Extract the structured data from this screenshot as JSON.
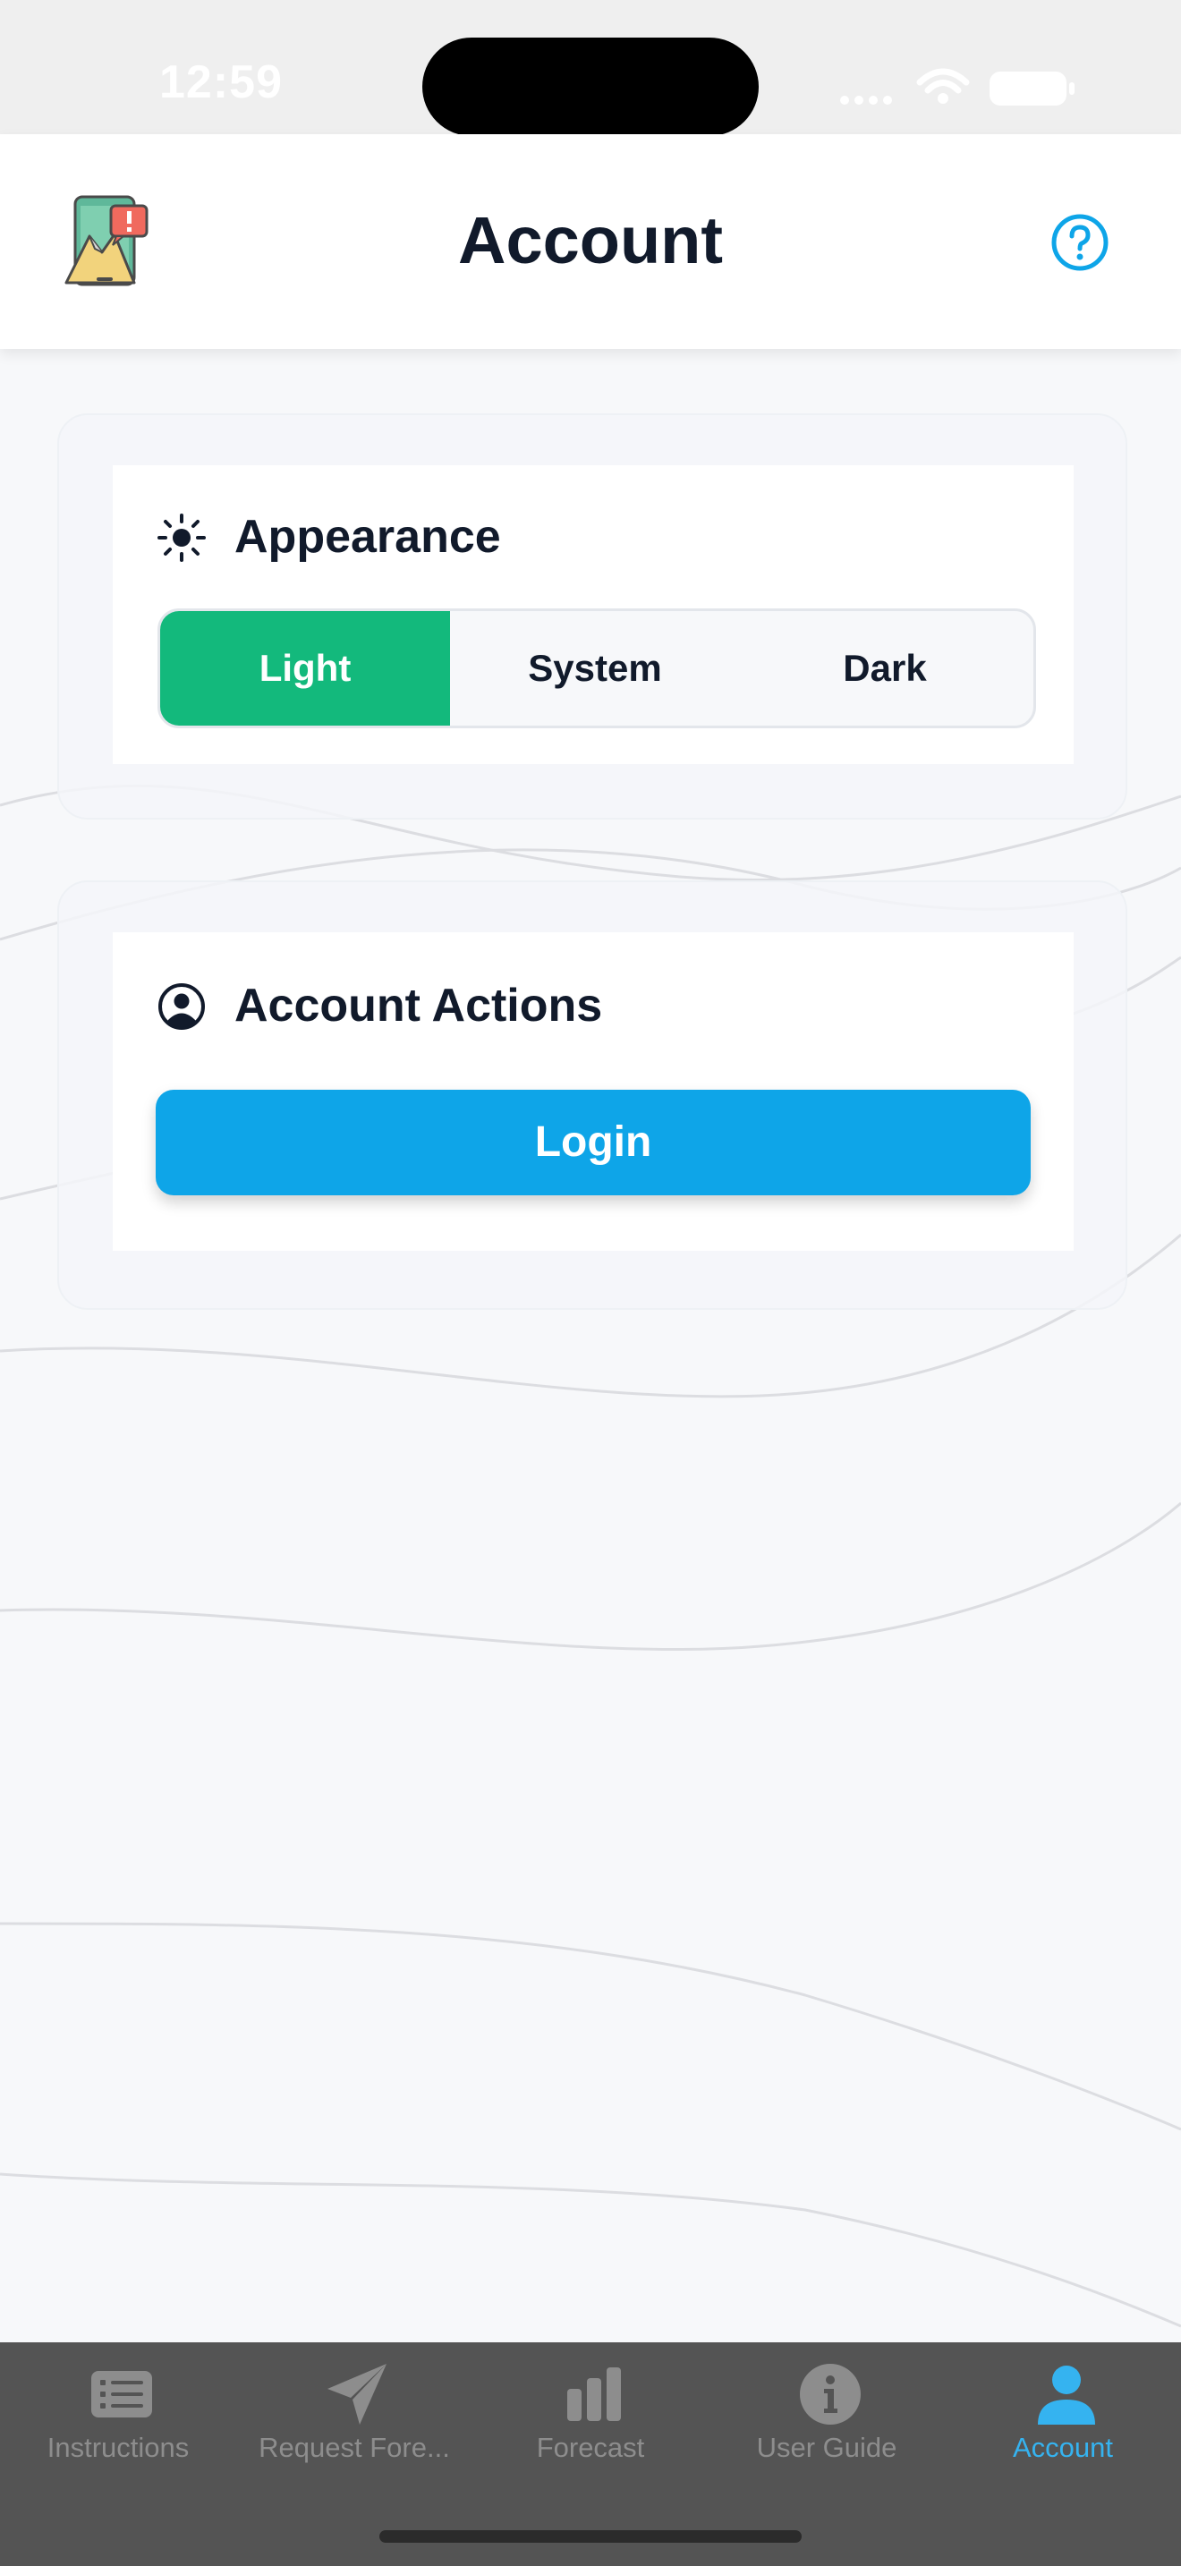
{
  "status_bar": {
    "time": "12:59"
  },
  "header": {
    "title": "Account"
  },
  "appearance": {
    "title": "Appearance",
    "options": [
      "Light",
      "System",
      "Dark"
    ],
    "selected": "Light"
  },
  "account_actions": {
    "title": "Account Actions",
    "login_label": "Login"
  },
  "tab_bar": {
    "tabs": [
      {
        "label": "Instructions",
        "icon": "list-icon"
      },
      {
        "label": "Request Fore...",
        "icon": "send-icon"
      },
      {
        "label": "Forecast",
        "icon": "bar-chart-icon"
      },
      {
        "label": "User Guide",
        "icon": "info-icon"
      },
      {
        "label": "Account",
        "icon": "person-icon"
      }
    ],
    "active": "Account"
  },
  "colors": {
    "accent_green": "#13b97c",
    "accent_blue": "#0ea5e8",
    "tab_active": "#35b3f0",
    "tab_inactive": "#8d8d8d"
  }
}
